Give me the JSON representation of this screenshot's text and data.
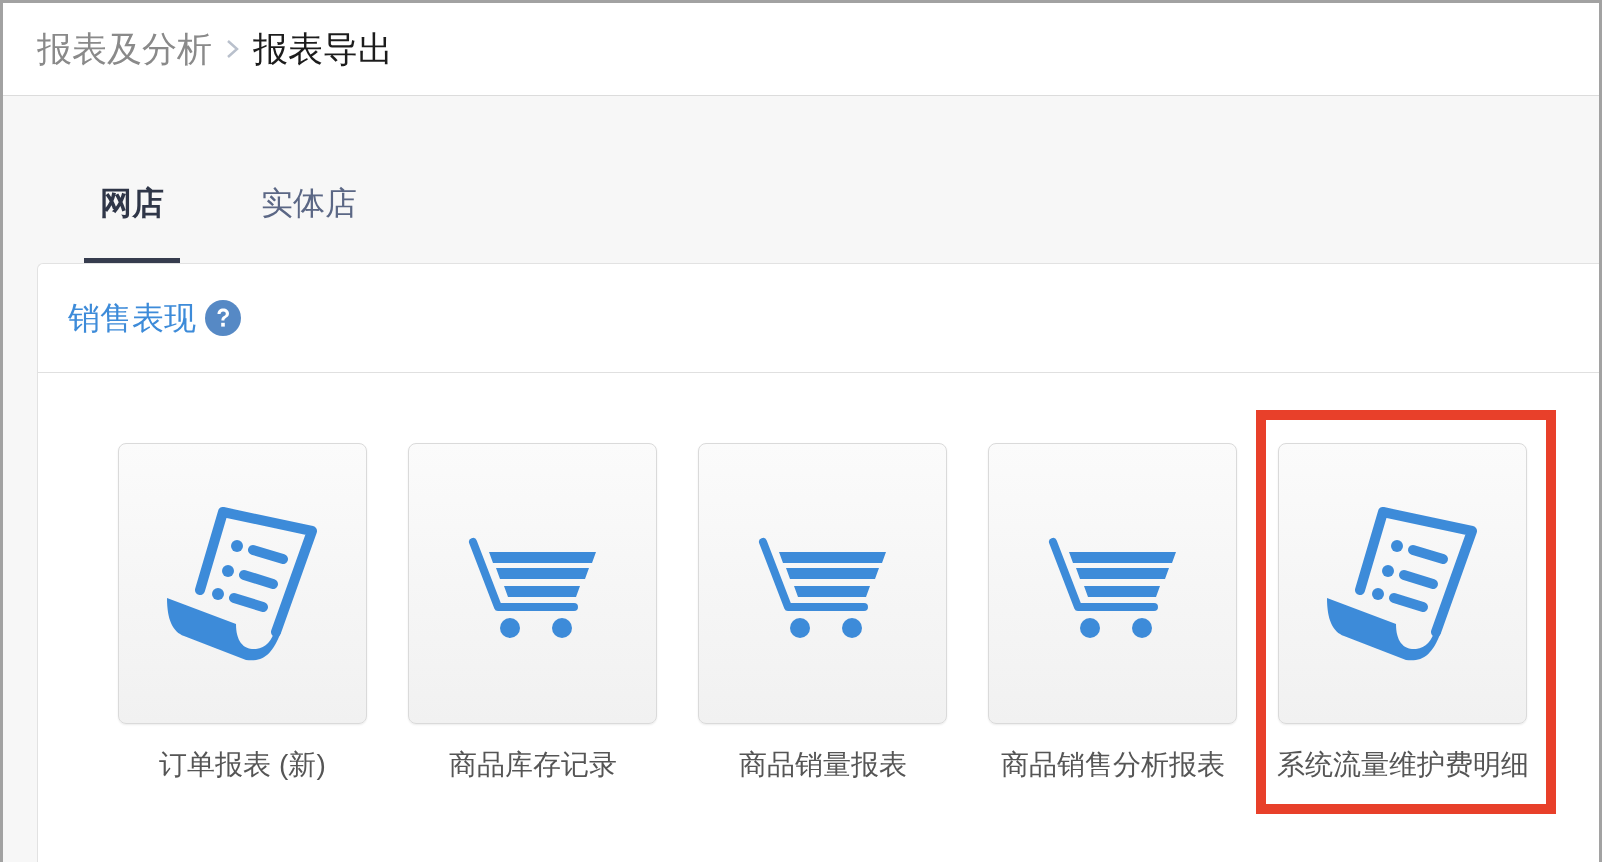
{
  "breadcrumb": [
    {
      "label": "报表及分析",
      "current": false
    },
    {
      "label": "报表导出",
      "current": true
    }
  ],
  "tabs": [
    {
      "label": "网店",
      "selected": true
    },
    {
      "label": "实体店",
      "selected": false
    }
  ],
  "section": {
    "title": "销售表现"
  },
  "reports": [
    {
      "kind": "document",
      "label": "订单报表 (新)",
      "highlighted": false
    },
    {
      "kind": "cart",
      "label": "商品库存记录",
      "highlighted": false
    },
    {
      "kind": "cart",
      "label": "商品销量报表",
      "highlighted": false
    },
    {
      "kind": "cart",
      "label": "商品销售分析报表",
      "highlighted": false
    },
    {
      "kind": "document",
      "label": "系统流量维护费明细",
      "highlighted": true
    }
  ]
}
